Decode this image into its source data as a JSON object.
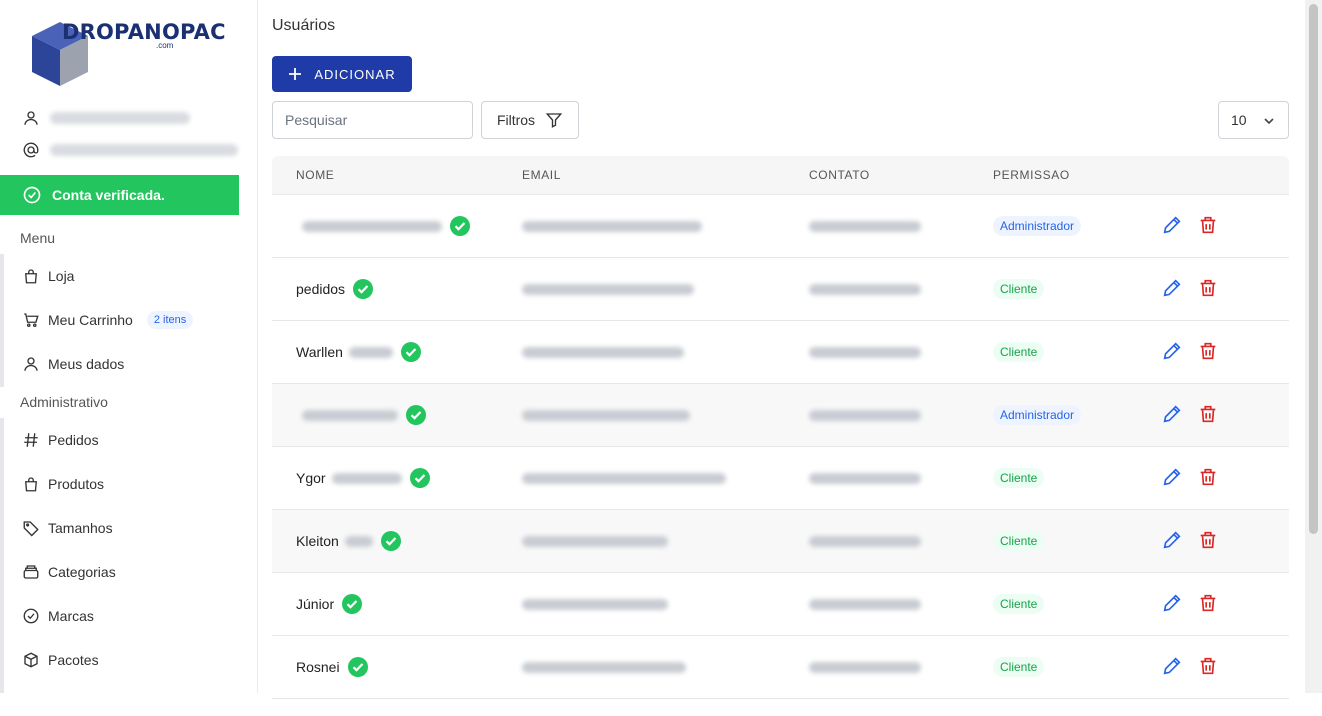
{
  "brand": {
    "name": "DROPANOPAC",
    "sub": ".com"
  },
  "user": {
    "name_hidden": "",
    "email_hidden": ""
  },
  "verified": {
    "text": "Conta verificada."
  },
  "menu": {
    "label": "Menu",
    "items": [
      {
        "label": "Loja",
        "icon": "bag-icon"
      },
      {
        "label": "Meu Carrinho",
        "icon": "cart-icon",
        "badge": "2 itens"
      },
      {
        "label": "Meus dados",
        "icon": "user-icon"
      }
    ]
  },
  "admin": {
    "label": "Administrativo",
    "items": [
      {
        "label": "Pedidos",
        "icon": "hash-icon"
      },
      {
        "label": "Produtos",
        "icon": "bag-icon"
      },
      {
        "label": "Tamanhos",
        "icon": "tag-icon"
      },
      {
        "label": "Categorias",
        "icon": "layers-icon"
      },
      {
        "label": "Marcas",
        "icon": "check-circle-icon"
      },
      {
        "label": "Pacotes",
        "icon": "box-icon"
      }
    ]
  },
  "page": {
    "title": "Usuários",
    "add_label": "ADICIONAR",
    "search_placeholder": "Pesquisar",
    "filter_label": "Filtros",
    "page_size": "10"
  },
  "table": {
    "headers": [
      "NOME",
      "EMAIL",
      "CONTATO",
      "PERMISSAO"
    ],
    "rows": [
      {
        "name": "",
        "perm": "Administrador"
      },
      {
        "name": "pedidos",
        "perm": "Cliente"
      },
      {
        "name": "Warllen",
        "perm": "Cliente"
      },
      {
        "name": "",
        "perm": "Administrador"
      },
      {
        "name": "Ygor",
        "perm": "Cliente"
      },
      {
        "name": "Kleiton",
        "perm": "Cliente"
      },
      {
        "name": "Júnior",
        "perm": "Cliente"
      },
      {
        "name": "Rosnei",
        "perm": "Cliente"
      }
    ]
  },
  "colors": {
    "accent": "#1e3ba8",
    "success": "#22c55e",
    "edit": "#2563eb",
    "delete": "#dc2626"
  }
}
